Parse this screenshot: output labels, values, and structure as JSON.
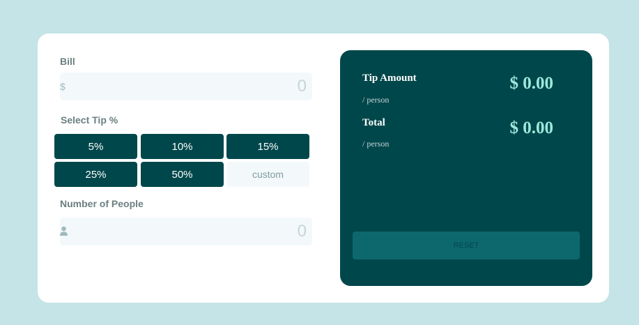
{
  "bill": {
    "label": "Bill",
    "currency_prefix": "$",
    "placeholder": "0"
  },
  "tip": {
    "label": "Select Tip %",
    "options": [
      "5%",
      "10%",
      "15%",
      "25%",
      "50%"
    ],
    "custom_placeholder": "custom"
  },
  "people": {
    "label": "Number of People",
    "icon": "person-icon",
    "placeholder": "0"
  },
  "results": {
    "tip_amount_label": "Tip Amount",
    "tip_amount_sub": "/ person",
    "tip_amount_value": "$ 0.00",
    "total_label": "Total",
    "total_sub": "/ person",
    "total_value": "$ 0.00",
    "reset_label": "RESET"
  },
  "colors": {
    "background": "#c5e4e7",
    "dark_cyan": "#00474b",
    "accent": "#9ee8dc",
    "reset_bg": "#0d686d"
  }
}
